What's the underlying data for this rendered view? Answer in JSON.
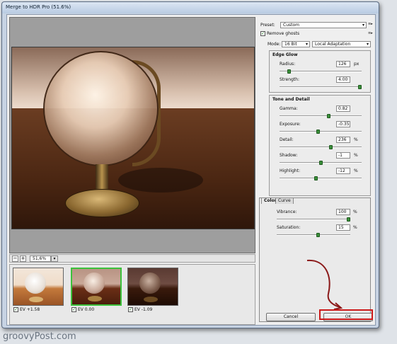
{
  "window": {
    "title": "Merge to HDR Pro (51.6%)"
  },
  "preview": {
    "zoom_value": "51,6%",
    "zoom_out_label": "−",
    "zoom_in_label": "+",
    "zoom_drop_label": "▾"
  },
  "thumbnails": [
    {
      "label": "EV +1.58",
      "checked": true
    },
    {
      "label": "EV 0.00",
      "checked": true
    },
    {
      "label": "EV -1.09",
      "checked": true
    }
  ],
  "controls": {
    "preset_label": "Preset:",
    "preset_value": "Custom",
    "remove_ghosts_label": "Remove ghosts",
    "mode_label": "Mode:",
    "mode_bits": "16 Bit",
    "mode_method": "Local Adaptation",
    "menu_icon_label": "≡▸"
  },
  "edge_glow": {
    "title": "Edge Glow",
    "radius_label": "Radius:",
    "radius_value": "126",
    "radius_unit": "px",
    "radius_level": 0.1,
    "strength_label": "Strength:",
    "strength_value": "4.00",
    "strength_level": 1.0
  },
  "tone_detail": {
    "title": "Tone and Detail",
    "gamma_label": "Gamma:",
    "gamma_value": "0.82",
    "gamma_level": 0.6,
    "exposure_label": "Exposure:",
    "exposure_value": "-0.35",
    "exposure_level": 0.47,
    "detail_label": "Detail:",
    "detail_value": "236",
    "detail_unit": "%",
    "detail_level": 0.63,
    "shadow_label": "Shadow:",
    "shadow_value": "-1",
    "shadow_unit": "%",
    "shadow_level": 0.5,
    "highlight_label": "Highlight:",
    "highlight_value": "-12",
    "highlight_unit": "%",
    "highlight_level": 0.44
  },
  "tabs": {
    "color_label": "Color",
    "curve_label": "Curve"
  },
  "color_tab": {
    "vibrance_label": "Vibrance:",
    "vibrance_value": "100",
    "vibrance_unit": "%",
    "vibrance_level": 1.0,
    "saturation_label": "Saturation:",
    "saturation_value": "15",
    "saturation_unit": "%",
    "saturation_level": 0.57
  },
  "buttons": {
    "cancel_label": "Cancel",
    "ok_label": "OK"
  },
  "watermark": "groovyPost.com",
  "colors": {
    "highlight_border": "#cc1a1a",
    "arrow": "#8b1a1a",
    "selected_thumb": "#3cc23c"
  }
}
